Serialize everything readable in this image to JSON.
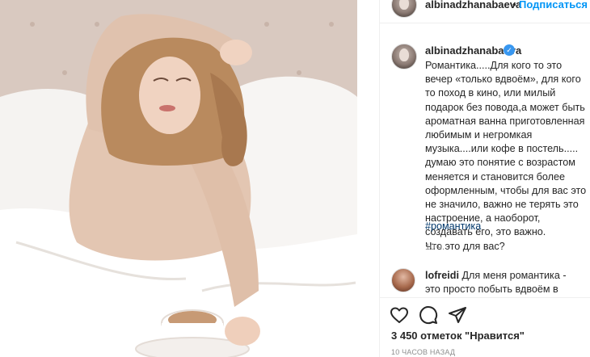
{
  "post": {
    "username": "albinadzhanabaeva",
    "separator": "•",
    "follow_label": "Подписаться",
    "verified_mark": "✓",
    "caption": "Романтика.....Для кого то это вечер «только вдвоём», для кого то поход в кино, или милый подарок без повода,а может быть ароматная ванна приготовленная любимым и негромкая музыка....или кофе в постель..... думаю это понятие с возрастом меняется и становится более оформленным, чтобы для вас это не значило, важно не терять это настроение, а наоборот, создавать его, это важно.\nЧто это для вас?",
    "hashtag": "#романтика",
    "caption_time": "10 ч.",
    "likes": "3 450 отметок \"Нравится\"",
    "post_time": "10 ЧАСОВ НАЗАД"
  },
  "comment": {
    "username": "lofreidi",
    "text": "Для меня романтика - это просто побыть вдвоём в"
  },
  "icons": {
    "like": "heart-icon",
    "comment": "comment-icon",
    "share": "share-icon"
  },
  "colors": {
    "accent": "#0095f6",
    "hashtag": "#00376b",
    "verified": "#3897f0",
    "muted": "#8e8e8e"
  }
}
